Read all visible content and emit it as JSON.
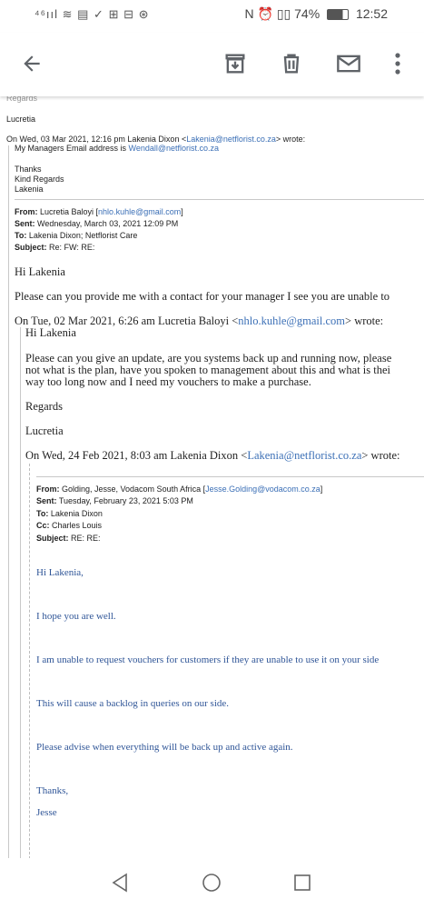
{
  "status": {
    "left_icons": "⁴⁶ııl ≋ ▤ ✓ ⊞ ⊟ ⊛",
    "right_icons": "N ⏰ ▯▯",
    "battery": "74%",
    "time": "12:52"
  },
  "toolbar": {
    "back": "back-arrow-icon",
    "archive": "archive-icon",
    "delete": "trash-icon",
    "mail": "mail-icon",
    "more": "more-vert-icon"
  },
  "email": {
    "regards_cut": "Regards",
    "signoff_name": "Lucretia",
    "wrote1_prefix": "On Wed, 03 Mar 2021, 12:16 pm Lakenia Dixon <",
    "wrote1_email": "Lakenia@netflorist.co.za",
    "wrote1_suffix": "> wrote:",
    "managers_text": "My Managers Email address is ",
    "managers_email": "Wendall@netflorist.co.za",
    "thanks": "Thanks",
    "kind_regards": "Kind Regards",
    "lakenia": "Lakenia",
    "from_label": "From:",
    "from_name": " Lucretia Baloyi [",
    "from_email": "nhlo.kuhle@gmail.com",
    "from_close": "]",
    "sent_label": "Sent:",
    "sent_value": " Wednesday, March 03, 2021 12:09 PM",
    "to_label": "To:",
    "to_value": " Lakenia Dixon; Netflorist Care",
    "subject_label": "Subject:",
    "subject_value": " Re: FW: RE:",
    "hi_lakenia": "Hi Lakenia",
    "please_provide": "Please can you provide me with a contact for your manager I see you are unable to",
    "on_tue_prefix": "On Tue, 02 Mar 2021, 6:26 am Lucretia Baloyi <",
    "on_tue_email": "nhlo.kuhle@gmail.com",
    "on_tue_suffix": "> wrote:",
    "hi_lakenia2": "Hi Lakenia",
    "update_line1": "Please can you give an update, are you systems back up and running now, please",
    "update_line2": "not what is the plan, have you spoken to management about this and what is thei",
    "update_line3": "way too long now and I need my vouchers to make a purchase.",
    "regards": "Regards",
    "lucretia": "Lucretia",
    "on_wed_prefix": "On Wed, 24 Feb 2021, 8:03 am Lakenia Dixon <",
    "on_wed_email": "Lakenia@netflorist.co.za",
    "on_wed_suffix": "> wrote:",
    "q_from_label": "From:",
    "q_from_value": " Golding, Jesse, Vodacom South Africa [",
    "q_from_email": "Jesse.Golding@vodacom.co.za",
    "q_from_close": "]",
    "q_sent_label": "Sent:",
    "q_sent_value": " Tuesday, February 23, 2021 5:03 PM",
    "q_to_label": "To:",
    "q_to_value": " Lakenia Dixon",
    "q_cc_label": "Cc:",
    "q_cc_value": " Charles Louis",
    "q_subject_label": "Subject:",
    "q_subject_value": " RE: RE:",
    "q_hi": "Hi Lakenia,",
    "q_hope": "I hope you are well.",
    "q_unable": "I am unable to request vouchers for customers if they are unable to use it on your side",
    "q_backlog": "This will cause a backlog in queries on our side.",
    "q_advise": "Please advise when everything will be back up and active again.",
    "q_thanks": "Thanks,",
    "q_jesse": "Jesse"
  },
  "nav": {
    "back": "nav-back-icon",
    "home": "nav-home-icon",
    "recents": "nav-recents-icon"
  }
}
